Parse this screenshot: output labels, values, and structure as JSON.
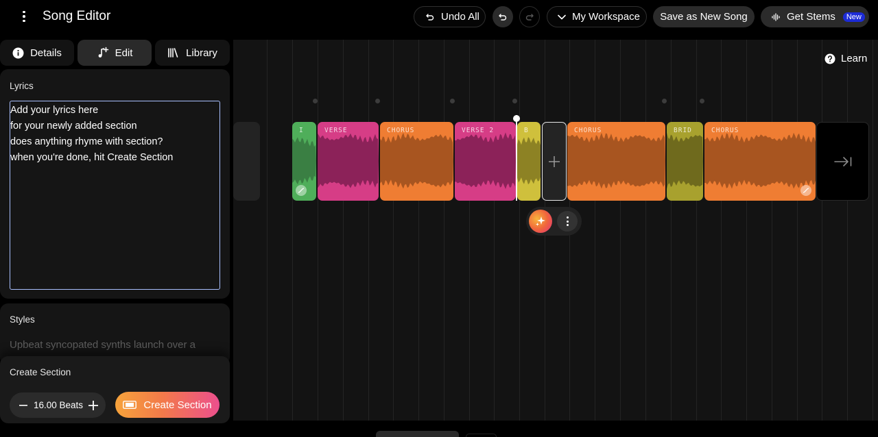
{
  "header": {
    "title": "Song Editor",
    "undo_all": "Undo All",
    "workspace": "My Workspace",
    "save_as_new": "Save as New Song",
    "get_stems": "Get Stems",
    "new_badge": "New"
  },
  "tabs": [
    {
      "label": "Details",
      "icon": "info-icon"
    },
    {
      "label": "Edit",
      "icon": "music-plus-icon",
      "active": true
    },
    {
      "label": "Library",
      "icon": "library-icon"
    }
  ],
  "lyrics": {
    "label": "Lyrics",
    "lines": [
      "Add your lyrics here",
      "for your newly added section",
      "does anything rhyme with section?",
      "when you're done, hit Create Section"
    ]
  },
  "styles": {
    "label": "Styles",
    "text": "Upbeat syncopated synths launch over a driving four-on-the-floor kick. Pulsing"
  },
  "create_section": {
    "label": "Create Section",
    "beats": "16.00 Beats",
    "button": "Create Section"
  },
  "timeline": {
    "learn": "Learn",
    "sections": [
      {
        "label": "I",
        "color": "#4fae5a",
        "wave": "#3a7f43"
      },
      {
        "label": "VERSE",
        "color": "#d63d86",
        "wave": "#8c2259"
      },
      {
        "label": "CHORUS",
        "color": "#ef7d33",
        "wave": "#a85520"
      },
      {
        "label": "VERSE 2",
        "color": "#d63d86",
        "wave": "#8c2259"
      },
      {
        "label": "B",
        "color": "#cfc03c",
        "wave": "#8d8224"
      },
      {
        "label": "CHORUS",
        "color": "#ef7d33",
        "wave": "#a85520"
      },
      {
        "label": "BRID",
        "color": "#a8a12e",
        "wave": "#6f6a1d"
      },
      {
        "label": "CHORUS",
        "color": "#ef7d33",
        "wave": "#a85520"
      }
    ]
  }
}
